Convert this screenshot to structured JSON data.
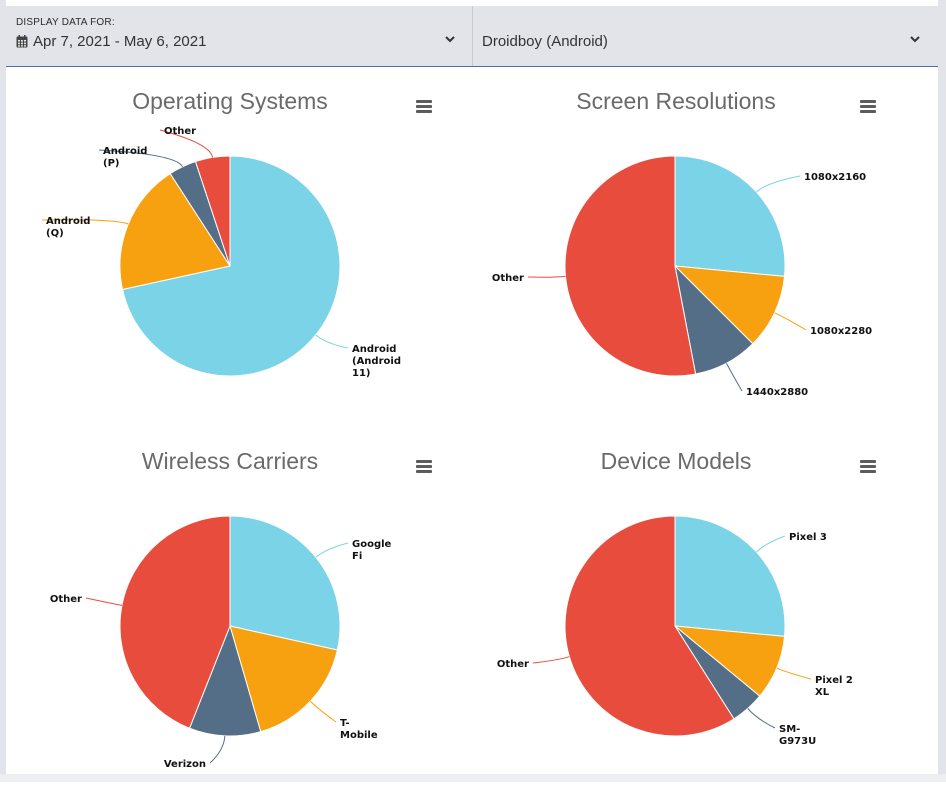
{
  "header": {
    "display_label": "DISPLAY DATA FOR:",
    "date_range": "Apr 7, 2021 - May 6, 2021",
    "app_selected": "Droidboy (Android)"
  },
  "colors": {
    "cyan": "#7ad3e6",
    "orange": "#f7a010",
    "slate": "#546e87",
    "red": "#e84c3d"
  },
  "chart_data": [
    {
      "type": "pie",
      "title": "Operating Systems",
      "slices": [
        {
          "label": "Android (Android 11)",
          "lines": [
            "Android",
            "(Android",
            "11)"
          ],
          "value": 70.5,
          "color": "#7ad3e6"
        },
        {
          "label": "Android (Q)",
          "lines": [
            "Android",
            "(Q)"
          ],
          "value": 19.0,
          "color": "#f7a010"
        },
        {
          "label": "Android (P)",
          "lines": [
            "Android",
            "(P)"
          ],
          "value": 4.0,
          "color": "#546e87"
        },
        {
          "label": "Other",
          "lines": [
            "Other"
          ],
          "value": 5.0,
          "color": "#e84c3d"
        }
      ]
    },
    {
      "type": "pie",
      "title": "Screen Resolutions",
      "slices": [
        {
          "label": "1080x2160",
          "lines": [
            "1080x2160"
          ],
          "value": 26.5,
          "color": "#7ad3e6"
        },
        {
          "label": "1080x2280",
          "lines": [
            "1080x2280"
          ],
          "value": 11.0,
          "color": "#f7a010"
        },
        {
          "label": "1440x2880",
          "lines": [
            "1440x2880"
          ],
          "value": 9.5,
          "color": "#546e87"
        },
        {
          "label": "Other",
          "lines": [
            "Other"
          ],
          "value": 53.0,
          "color": "#e84c3d"
        }
      ]
    },
    {
      "type": "pie",
      "title": "Wireless Carriers",
      "slices": [
        {
          "label": "Google Fi",
          "lines": [
            "Google",
            "Fi"
          ],
          "value": 28.5,
          "color": "#7ad3e6"
        },
        {
          "label": "T-Mobile",
          "lines": [
            "T-",
            "Mobile"
          ],
          "value": 17.0,
          "color": "#f7a010"
        },
        {
          "label": "Verizon",
          "lines": [
            "Verizon"
          ],
          "value": 10.5,
          "color": "#546e87"
        },
        {
          "label": "Other",
          "lines": [
            "Other"
          ],
          "value": 44.0,
          "color": "#e84c3d"
        }
      ]
    },
    {
      "type": "pie",
      "title": "Device Models",
      "slices": [
        {
          "label": "Pixel 3",
          "lines": [
            "Pixel 3"
          ],
          "value": 26.5,
          "color": "#7ad3e6"
        },
        {
          "label": "Pixel 2 XL",
          "lines": [
            "Pixel 2",
            "XL"
          ],
          "value": 9.5,
          "color": "#f7a010"
        },
        {
          "label": "SM-G973U",
          "lines": [
            "SM-",
            "G973U"
          ],
          "value": 5.0,
          "color": "#546e87"
        },
        {
          "label": "Other",
          "lines": [
            "Other"
          ],
          "value": 59.0,
          "color": "#e84c3d"
        }
      ]
    }
  ]
}
